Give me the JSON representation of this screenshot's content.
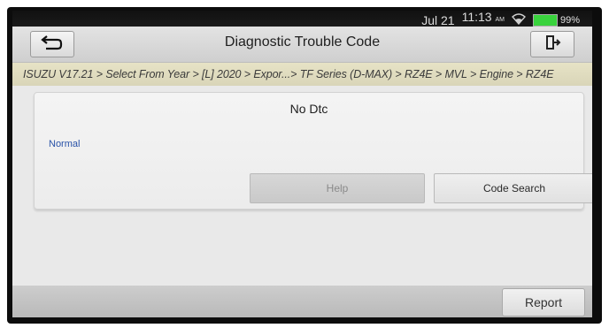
{
  "status_bar": {
    "date": "Jul 21",
    "time": "11:13",
    "ampm": "AM",
    "battery": "99%",
    "icons": [
      "wifi-icon",
      "battery-icon"
    ]
  },
  "header": {
    "title": "Diagnostic Trouble Code",
    "back_icon": "back-arrow-icon",
    "exit_icon": "exit-door-icon"
  },
  "breadcrumb": "ISUZU V17.21 > Select From Year > [L] 2020 > Expor...> TF Series (D-MAX) > RZ4E > MVL > Engine > RZ4E",
  "result": {
    "title": "No Dtc",
    "status": "Normal",
    "help_label": "Help",
    "code_search_label": "Code Search"
  },
  "footer": {
    "report_label": "Report"
  },
  "colors": {
    "status_text": "#2a53a8",
    "breadcrumb_bg": "#e2dec2",
    "battery": "#39d33d"
  }
}
